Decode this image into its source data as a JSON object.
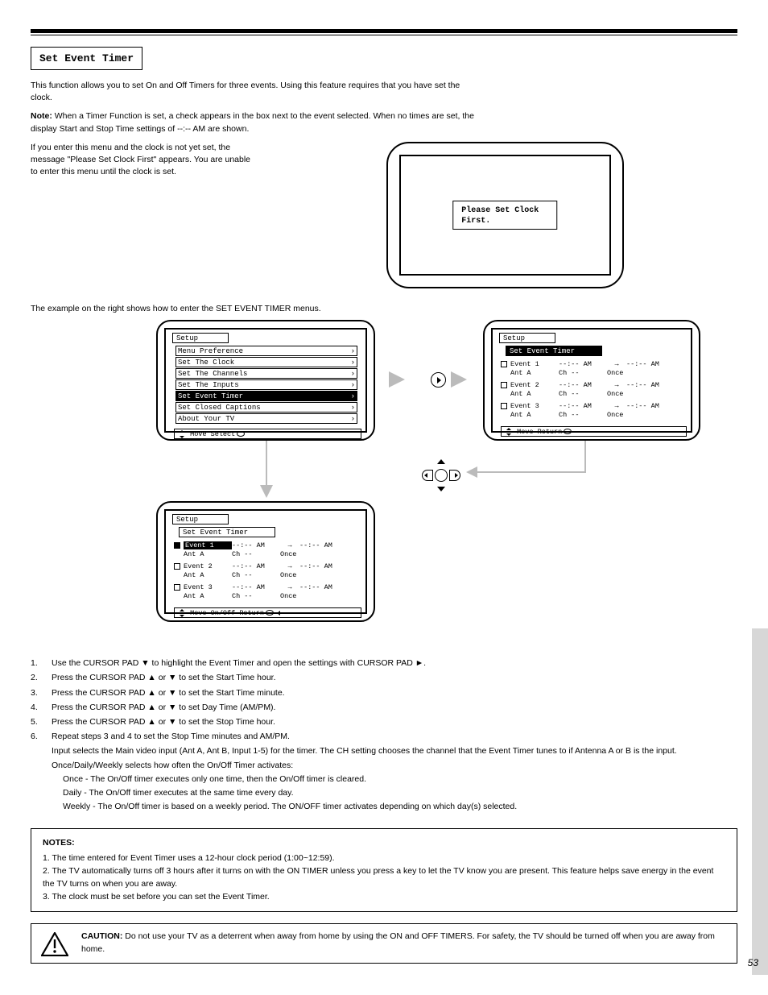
{
  "header": {
    "title": "Set Event Timer"
  },
  "intro": "This function allows you to set On and Off Timers for three events. Using this feature requires that you have set the clock.",
  "note": {
    "prefix": "Note:",
    "text": "When a Timer Function is set, a check appears in the box next to the event selected. When no times are set, the display Start and Stop Time settings of --:-- AM are shown."
  },
  "clock_warning": {
    "line1": "If you enter this menu and the clock is not yet set, the message \"Please Set Clock First\" appears. You are unable to enter this menu until the clock is set.",
    "msg": "Please Set Clock First."
  },
  "instr_head": "The example on the right shows how to enter the SET EVENT TIMER menus.",
  "steps": {
    "s1": "Use the CURSOR PAD ▼ to highlight the Event Timer and open the settings with CURSOR PAD ►.",
    "s2": "Press the CURSOR PAD ▲ or ▼ to set the Start Time hour.",
    "s3": "Press the CURSOR PAD ▲ or ▼ to set the Start Time minute.",
    "s4": "Press the CURSOR PAD ▲ or ▼ to set Day Time (AM/PM).",
    "s5": "Press the CURSOR PAD ▲ or ▼ to set the Stop Time hour.",
    "s6_a": "Repeat steps 3 and 4 to set the Stop Time minutes and AM/PM.",
    "s6_b": "Input selects the Main video input (Ant A, Ant B, Input 1-5) for the timer. The CH setting chooses the channel that the Event Timer tunes to if Antenna A or B is the input.",
    "s6_c": "Once/Daily/Weekly selects how often the On/Off Timer activates:",
    "once": "Once - The On/Off timer executes only one time, then the On/Off timer is cleared.",
    "daily": "Daily - The On/Off timer executes at the same time every day.",
    "weekly": "Weekly - The On/Off timer is based on a weekly period. The ON/OFF timer activates depending on which day(s) selected."
  },
  "osd": {
    "setup": "Setup",
    "menu1": [
      "Menu Preference",
      "Set The Clock",
      "Set The Channels",
      "Set The Inputs",
      "Set Event Timer",
      "Set Closed Captions",
      "About Your TV"
    ],
    "help1": "Move       Select",
    "set_sub": "Set Event Timer",
    "events": [
      {
        "n": "Event 1",
        "t1": "--:-- AM",
        "t2": "--:-- AM",
        "ant": "Ant A",
        "ch": "Ch --",
        "rep": "Once"
      },
      {
        "n": "Event 2",
        "t1": "--:-- AM",
        "t2": "--:-- AM",
        "ant": "Ant A",
        "ch": "Ch --",
        "rep": "Once"
      },
      {
        "n": "Event 3",
        "t1": "--:-- AM",
        "t2": "--:-- AM",
        "ant": "Ant A",
        "ch": "Ch --",
        "rep": "Once"
      }
    ],
    "help2": "Move       Return",
    "help3": "Move       On/Off     Return"
  },
  "notes_box": {
    "title": "NOTES:",
    "n1": "1. The time entered for Event Timer uses a 12-hour clock period (1:00~12:59).",
    "n2": "2. The TV automatically turns off 3 hours after it turns on with the ON TIMER unless you press a key to let the TV know you are present. This feature helps save energy in the event the TV turns on when you are away.",
    "n3": "3. The clock must be set before you can set the Event Timer."
  },
  "caution": {
    "title": "CAUTION:",
    "text": "Do not use your TV as a deterrent when away from home by using the ON and OFF TIMERS. For safety, the TV should be turned off when you are away from home."
  },
  "page_num": "53"
}
